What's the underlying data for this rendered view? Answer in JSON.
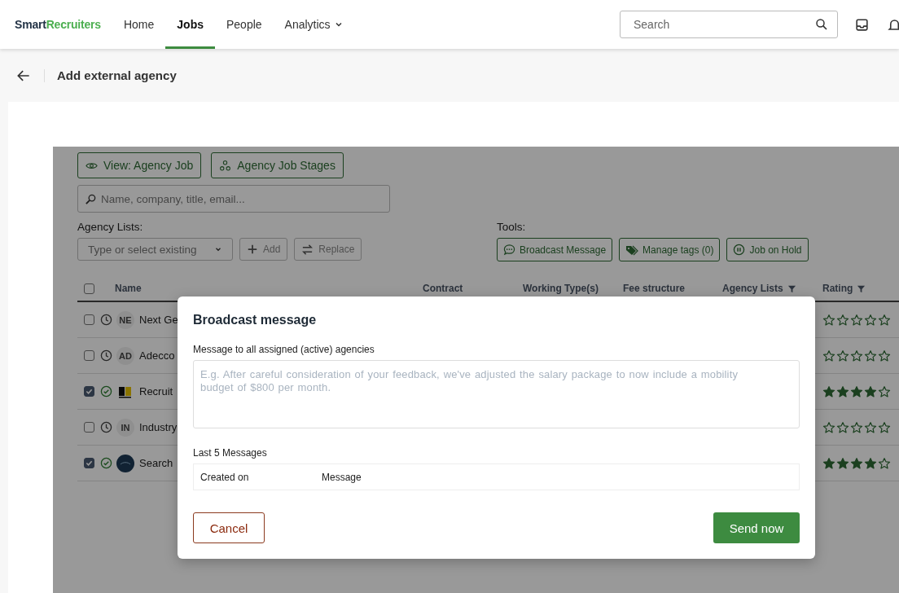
{
  "nav": {
    "logo": {
      "text": "Smart",
      "accent": "Recruiters"
    },
    "items": [
      {
        "label": "Home",
        "selected": false,
        "kind": "link"
      },
      {
        "label": "Jobs",
        "selected": true,
        "kind": "link"
      },
      {
        "label": "People",
        "selected": false,
        "kind": "link"
      },
      {
        "label": "Analytics",
        "selected": false,
        "kind": "dropdown"
      }
    ],
    "search": {
      "placeholder": "Search"
    }
  },
  "header": {
    "title": "Add external agency"
  },
  "panel": {
    "view_buttons": [
      {
        "label": "View: Agency Job",
        "kind": "eye"
      },
      {
        "label": "Agency Job Stages",
        "kind": "stages"
      }
    ],
    "search": {
      "placeholder": "Name, company, title, email..."
    },
    "agency_lists": {
      "label": "Agency Lists:",
      "select_placeholder": "Type or select existing",
      "buttons": [
        {
          "label": "Add",
          "kind": "add"
        },
        {
          "label": "Replace",
          "kind": "replace"
        }
      ]
    },
    "tools": {
      "label": "Tools:",
      "buttons": [
        {
          "label": "Broadcast Message",
          "kind": "chat"
        },
        {
          "label": "Manage tags (0)",
          "kind": "tag"
        },
        {
          "label": "Job on Hold",
          "kind": "pause"
        }
      ]
    },
    "table": {
      "select_all": {
        "checked": false
      },
      "columns": [
        {
          "label": "Name",
          "filter": false
        },
        {
          "label": "Contract",
          "filter": false
        },
        {
          "label": "Working Type(s)",
          "filter": false
        },
        {
          "label": "Fee structure",
          "filter": false
        },
        {
          "label": "Agency Lists",
          "filter": true
        },
        {
          "label": "Rating",
          "filter": true
        }
      ],
      "rows": [
        {
          "checked": false,
          "active": false,
          "avatar": {
            "kind": "initials",
            "text": "NE"
          },
          "name": "Next Ge",
          "stars": 0
        },
        {
          "checked": false,
          "active": false,
          "avatar": {
            "kind": "initials",
            "text": "AD"
          },
          "name": "Adecco",
          "stars": 0
        },
        {
          "checked": true,
          "active": true,
          "avatar": {
            "kind": "logo-mark"
          },
          "name": "Recruit",
          "stars": 4
        },
        {
          "checked": false,
          "active": false,
          "avatar": {
            "kind": "initials",
            "text": "IN"
          },
          "name": "Industry",
          "stars": 0
        },
        {
          "checked": true,
          "active": true,
          "avatar": {
            "kind": "logo-round"
          },
          "name": "Search",
          "stars": 4
        }
      ]
    }
  },
  "modal": {
    "title": "Broadcast message",
    "field_label": "Message to all assigned (active) agencies",
    "placeholder": "E.g. After careful consideration of your feedback, we've adjusted the salary package to now include a mobility budget of $800 per month.",
    "history_label": "Last 5 Messages",
    "history_columns": [
      "Created on",
      "Message"
    ],
    "cancel": "Cancel",
    "send": "Send now"
  }
}
